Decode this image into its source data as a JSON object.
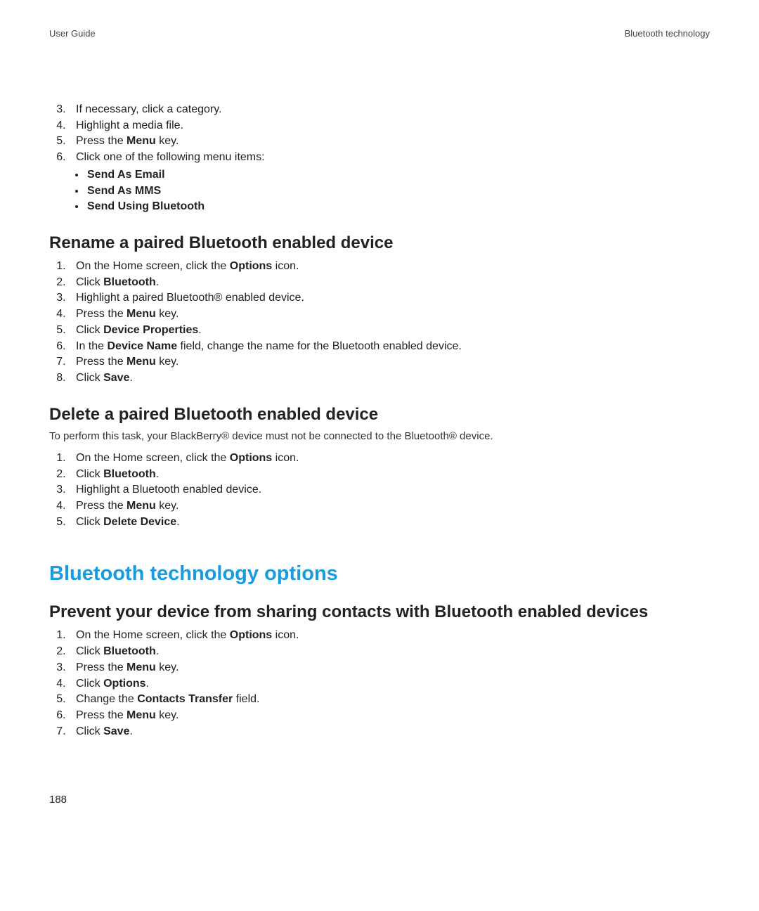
{
  "header": {
    "left": "User Guide",
    "right": "Bluetooth technology"
  },
  "top_list": {
    "start": 3,
    "items": [
      {
        "text": "If necessary, click a category."
      },
      {
        "text": "Highlight a media file."
      },
      {
        "pre": "Press the ",
        "bold": "Menu",
        "post": " key."
      },
      {
        "text": "Click one of the following menu items:",
        "bullets": [
          "Send As Email",
          "Send As MMS",
          "Send Using Bluetooth"
        ]
      }
    ]
  },
  "sec_rename": {
    "title": "Rename a paired Bluetooth enabled device",
    "items": [
      {
        "pre": "On the Home screen, click the ",
        "bold": "Options",
        "post": " icon."
      },
      {
        "pre": "Click ",
        "bold": "Bluetooth",
        "post": "."
      },
      {
        "text": "Highlight a paired Bluetooth® enabled device."
      },
      {
        "pre": "Press the ",
        "bold": "Menu",
        "post": " key."
      },
      {
        "pre": "Click ",
        "bold": "Device Properties",
        "post": "."
      },
      {
        "pre": "In the ",
        "bold": "Device Name",
        "post": " field, change the name for the Bluetooth enabled device."
      },
      {
        "pre": "Press the ",
        "bold": "Menu",
        "post": " key."
      },
      {
        "pre": "Click ",
        "bold": "Save",
        "post": "."
      }
    ]
  },
  "sec_delete": {
    "title": "Delete a paired Bluetooth enabled device",
    "note": "To perform this task, your BlackBerry® device must not be connected to the Bluetooth® device.",
    "items": [
      {
        "pre": "On the Home screen, click the ",
        "bold": "Options",
        "post": " icon."
      },
      {
        "pre": "Click ",
        "bold": "Bluetooth",
        "post": "."
      },
      {
        "text": "Highlight a Bluetooth enabled device."
      },
      {
        "pre": "Press the ",
        "bold": "Menu",
        "post": " key."
      },
      {
        "pre": "Click ",
        "bold": "Delete Device",
        "post": "."
      }
    ]
  },
  "h1": "Bluetooth technology options",
  "sec_prevent": {
    "title": "Prevent your device from sharing contacts with Bluetooth enabled devices",
    "items": [
      {
        "pre": "On the Home screen, click the ",
        "bold": "Options",
        "post": " icon."
      },
      {
        "pre": "Click ",
        "bold": "Bluetooth",
        "post": "."
      },
      {
        "pre": "Press the ",
        "bold": "Menu",
        "post": " key."
      },
      {
        "pre": "Click ",
        "bold": "Options",
        "post": "."
      },
      {
        "pre": "Change the ",
        "bold": "Contacts Transfer",
        "post": " field."
      },
      {
        "pre": "Press the ",
        "bold": "Menu",
        "post": " key."
      },
      {
        "pre": "Click ",
        "bold": "Save",
        "post": "."
      }
    ]
  },
  "page_number": "188"
}
